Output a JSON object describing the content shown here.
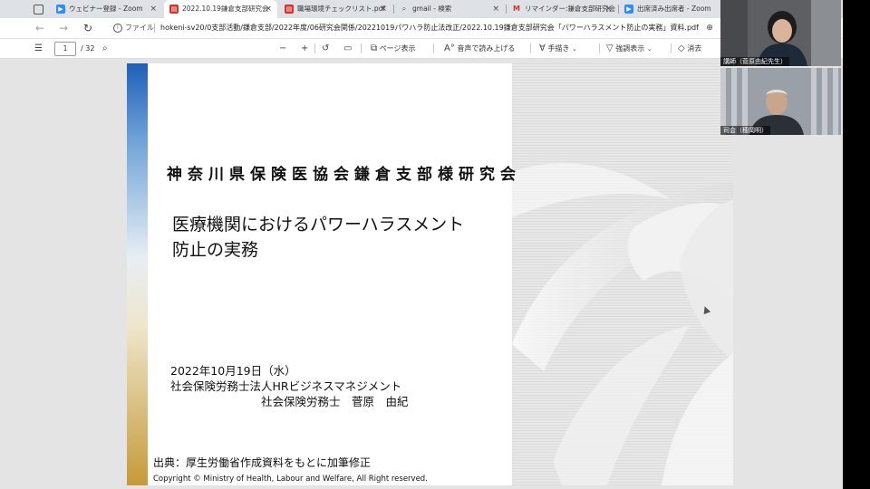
{
  "browser": {
    "tabs": [
      {
        "label": "ウェビナー登録 - Zoom",
        "icon": "zoom-icon",
        "active": false
      },
      {
        "label": "2022.10.19鎌倉支部研究会",
        "icon": "pdf-icon",
        "active": true
      },
      {
        "label": "職場環境チェックリスト.pdf",
        "icon": "pdf-icon",
        "active": false
      },
      {
        "label": "gmail - 検索",
        "icon": "search-icon",
        "active": false
      },
      {
        "label": "リマインダー:鎌倉支部研究会",
        "icon": "gmail-icon",
        "active": false
      },
      {
        "label": "出席済み出席者 - Zoom",
        "icon": "zoom-icon",
        "active": false
      }
    ],
    "file_label": "ファイル",
    "url": "hokeni-sv20/0支部活動/鎌倉支部/2022年度/06研究会関係/20221019パワハラ防止法改正/2022.10.19鎌倉支部研究会「パワーハラスメント防止の実務」資料.pdf"
  },
  "pdf_toolbar": {
    "page_current": "1",
    "page_total": "/ 32",
    "page_view": "ページ表示",
    "read_aloud": "音声で読み上げる",
    "draw": "手描き",
    "highlight": "強調表示",
    "erase": "消去"
  },
  "slide": {
    "org_title": "神奈川県保険医協会鎌倉支部様研究会",
    "main_title_line1": "医療機関におけるパワーハラスメント",
    "main_title_line2": "防止の実務",
    "date": "2022年10月19日（水）",
    "company": "社会保険労務士法人HRビジネスマネジメント",
    "presenter": "社会保険労務士　菅原　由紀",
    "source": "出典：厚生労働省作成資料をもとに加筆修正",
    "copyright": "Copyright © Ministry of Health, Labour and Welfare, All Right reserved."
  },
  "participants": [
    {
      "name": "講師（菅原由紀先生）"
    },
    {
      "name": "司会（穂岡明）"
    }
  ]
}
